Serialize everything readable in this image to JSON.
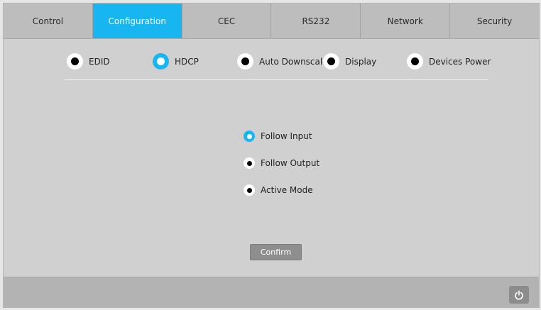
{
  "tabs": [
    {
      "label": "Control",
      "active": false
    },
    {
      "label": "Configuration",
      "active": true
    },
    {
      "label": "CEC",
      "active": false
    },
    {
      "label": "RS232",
      "active": false
    },
    {
      "label": "Network",
      "active": false
    },
    {
      "label": "Security",
      "active": false
    }
  ],
  "subnav": {
    "selected": "HDCP",
    "items": [
      {
        "label": "EDID",
        "selected": false
      },
      {
        "label": "HDCP",
        "selected": true
      },
      {
        "label": "Auto Downscale",
        "selected": false
      },
      {
        "label": "Display",
        "selected": false
      },
      {
        "label": "Devices Power",
        "selected": false
      }
    ]
  },
  "hdcp_options": {
    "selected": "Follow Input",
    "items": [
      {
        "label": "Follow Input",
        "selected": true
      },
      {
        "label": "Follow Output",
        "selected": false
      },
      {
        "label": "Active Mode",
        "selected": false
      }
    ]
  },
  "confirm_label": "Confirm",
  "footer": {
    "power_icon": "power-icon"
  },
  "colors": {
    "accent": "#18b6f1",
    "tab_bar": "#bdbdbd",
    "panel": "#d0d0d0",
    "footer": "#b3b3b3",
    "button": "#8e8e8e"
  }
}
